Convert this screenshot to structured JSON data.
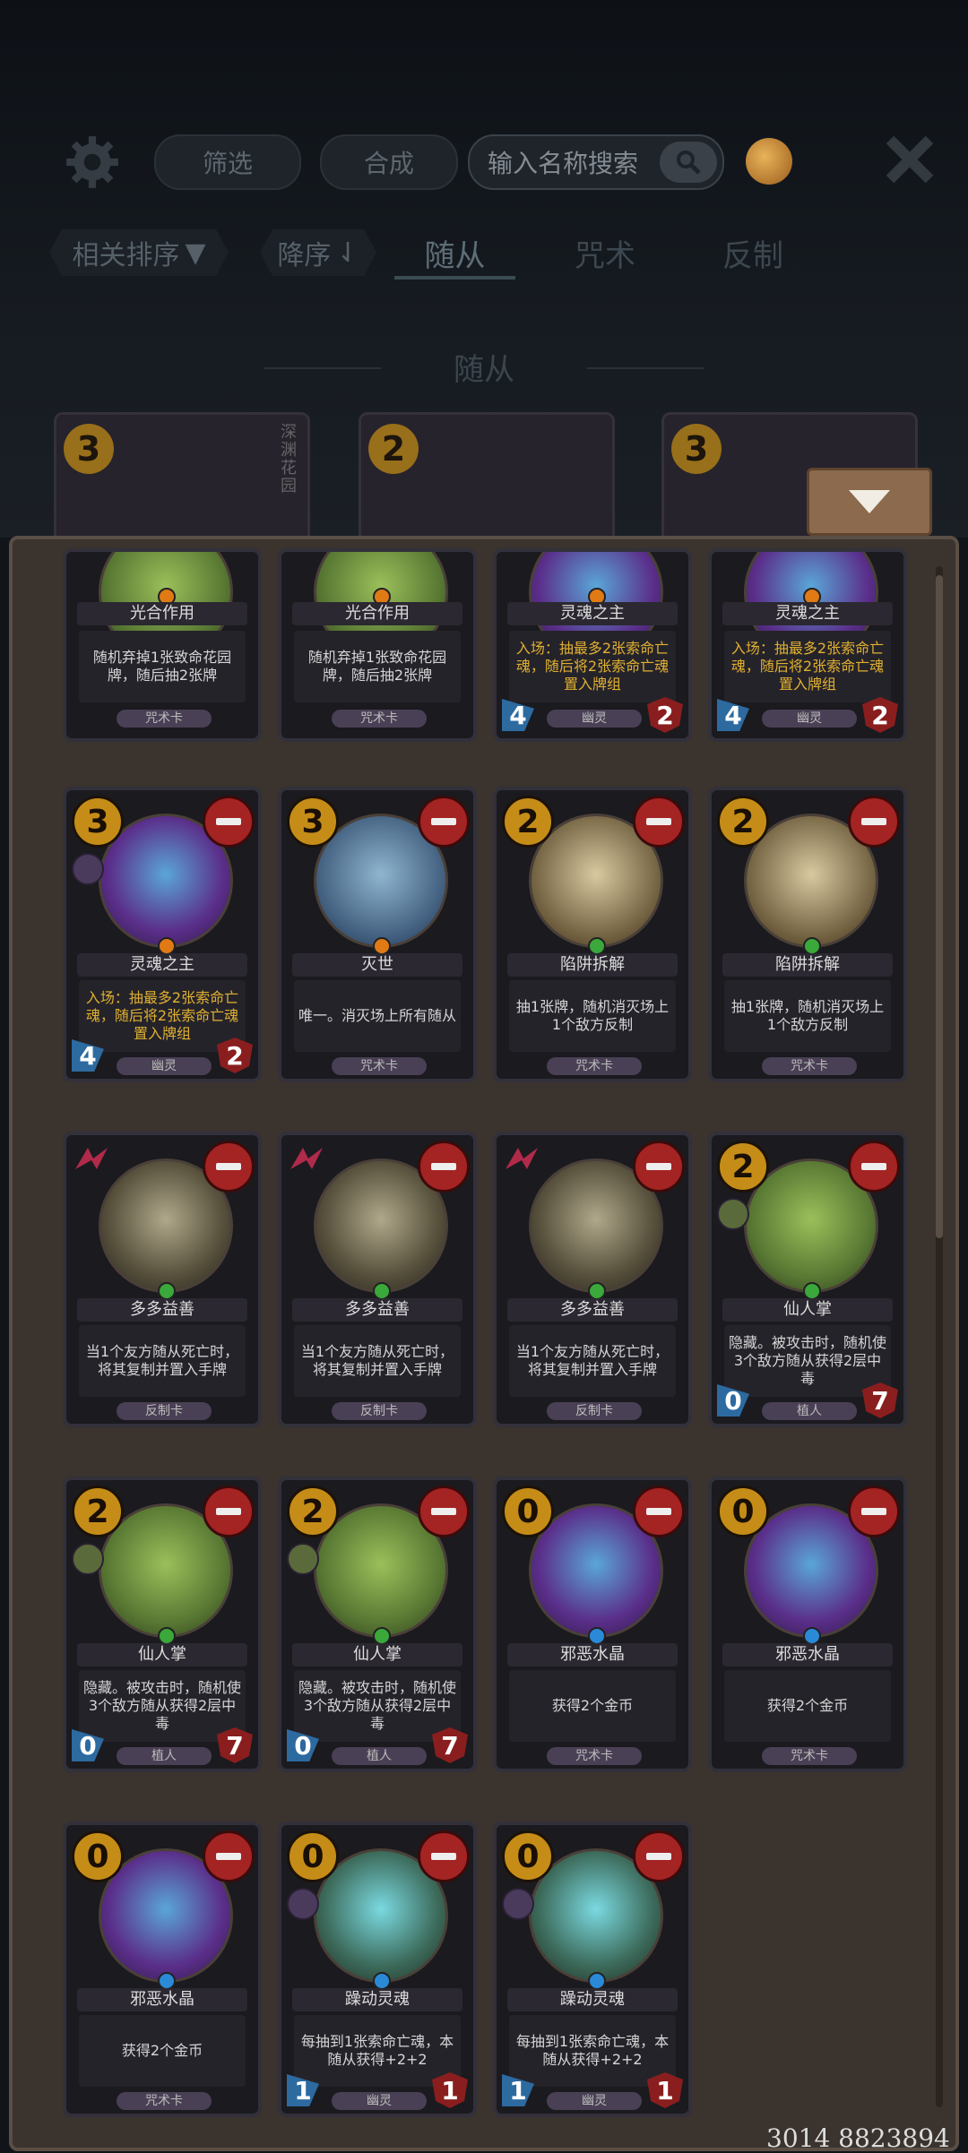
{
  "toolbar": {
    "filter_label": "筛选",
    "compose_label": "合成",
    "search_placeholder": "输入名称搜索"
  },
  "tabs": {
    "sort_label": "相关排序",
    "order_label": "降序",
    "items": [
      "随从",
      "咒术",
      "反制"
    ],
    "active": "随从"
  },
  "section_title": "随从",
  "background_cards": [
    {
      "cost": "3",
      "tag": "深渊花园"
    },
    {
      "cost": "2"
    },
    {
      "cost": "3"
    }
  ],
  "cards": [
    {
      "name": "光合作用",
      "desc": "随机弃掉1张致命花园牌，随后抽2张牌",
      "type": "咒术卡",
      "gem": "#e07a14"
    },
    {
      "name": "光合作用",
      "desc": "随机弃掉1张致命花园牌，随后抽2张牌",
      "type": "咒术卡",
      "gem": "#e07a14"
    },
    {
      "name": "灵魂之主",
      "desc": "入场：抽最多2张索命亡魂，随后将2张索命亡魂置入牌组",
      "type": "幽灵",
      "atk": "4",
      "hp": "2",
      "gem": "#e07a14"
    },
    {
      "name": "灵魂之主",
      "desc": "入场：抽最多2张索命亡魂，随后将2张索命亡魂置入牌组",
      "type": "幽灵",
      "atk": "4",
      "hp": "2",
      "gem": "#e07a14"
    },
    {
      "cost": "3",
      "name": "灵魂之主",
      "desc": "入场：抽最多2张索命亡魂，随后将2张索命亡魂置入牌组",
      "type": "幽灵",
      "atk": "4",
      "hp": "2",
      "gem": "#e07a14"
    },
    {
      "cost": "3",
      "name": "灭世",
      "desc": "唯一。消灭场上所有随从",
      "type": "咒术卡",
      "gem": "#e07a14"
    },
    {
      "cost": "2",
      "name": "陷阱拆解",
      "desc": "抽1张牌，随机消灭场上1个敌方反制",
      "type": "咒术卡",
      "gem": "#3aa83a"
    },
    {
      "cost": "2",
      "name": "陷阱拆解",
      "desc": "抽1张牌，随机消灭场上1个敌方反制",
      "type": "咒术卡",
      "gem": "#3aa83a"
    },
    {
      "name": "多多益善",
      "desc": "当1个友方随从死亡时，将其复制并置入手牌",
      "type": "反制卡",
      "gem": "#3aa83a"
    },
    {
      "name": "多多益善",
      "desc": "当1个友方随从死亡时，将其复制并置入手牌",
      "type": "反制卡",
      "gem": "#3aa83a"
    },
    {
      "name": "多多益善",
      "desc": "当1个友方随从死亡时，将其复制并置入手牌",
      "type": "反制卡",
      "gem": "#3aa83a"
    },
    {
      "cost": "2",
      "name": "仙人掌",
      "desc": "隐藏。被攻击时，随机使3个敌方随从获得2层中毒",
      "type": "植人",
      "atk": "0",
      "hp": "7",
      "gem": "#3aa83a"
    },
    {
      "cost": "2",
      "name": "仙人掌",
      "desc": "隐藏。被攻击时，随机使3个敌方随从获得2层中毒",
      "type": "植人",
      "atk": "0",
      "hp": "7",
      "gem": "#3aa83a"
    },
    {
      "cost": "2",
      "name": "仙人掌",
      "desc": "隐藏。被攻击时，随机使3个敌方随从获得2层中毒",
      "type": "植人",
      "atk": "0",
      "hp": "7",
      "gem": "#3aa83a"
    },
    {
      "cost": "0",
      "name": "邪恶水晶",
      "desc": "获得2个金币",
      "type": "咒术卡",
      "gem": "#2a8ad8"
    },
    {
      "cost": "0",
      "name": "邪恶水晶",
      "desc": "获得2个金币",
      "type": "咒术卡",
      "gem": "#2a8ad8"
    },
    {
      "cost": "0",
      "name": "邪恶水晶",
      "desc": "获得2个金币",
      "type": "咒术卡",
      "gem": "#2a8ad8"
    },
    {
      "cost": "0",
      "name": "躁动灵魂",
      "desc": "每抽到1张索命亡魂，本随从获得+2+2",
      "type": "幽灵",
      "atk": "1",
      "hp": "1",
      "gem": "#2a8ad8"
    },
    {
      "cost": "0",
      "name": "躁动灵魂",
      "desc": "每抽到1张索命亡魂，本随从获得+2+2",
      "type": "幽灵",
      "atk": "1",
      "hp": "1",
      "gem": "#2a8ad8"
    }
  ],
  "footer_id": "3014 8823894",
  "colors": {
    "accent_gold": "#c58d18",
    "remove_red": "#a42323",
    "panel": "#3a332e"
  }
}
